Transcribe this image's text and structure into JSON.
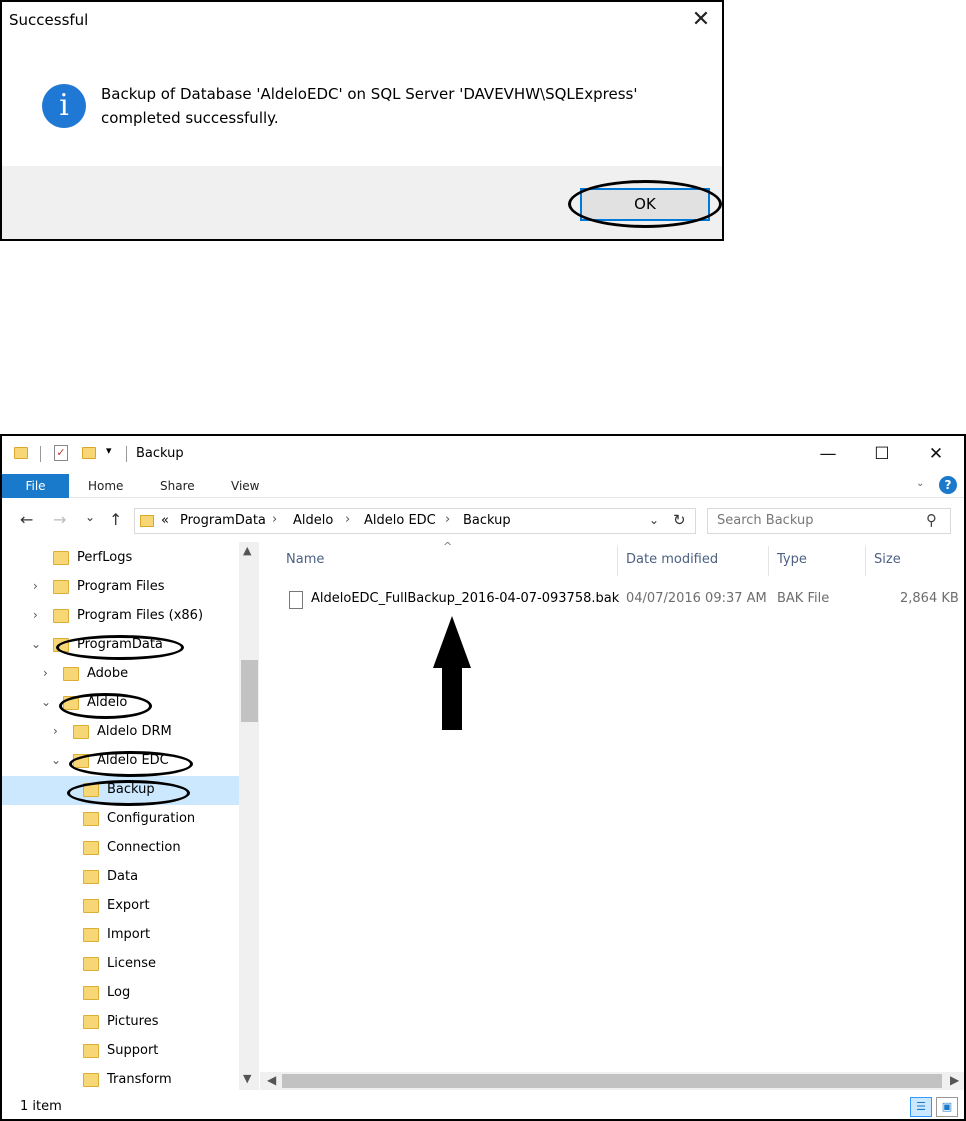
{
  "dialog": {
    "title": "Successful",
    "close_glyph": "✕",
    "icon": "information-icon",
    "icon_glyph": "i",
    "message_line1": "Backup of Database 'AldeloEDC' on SQL Server 'DAVEVHW\\SQLExpress'",
    "message_line2": "completed successfully.",
    "ok_label": "OK"
  },
  "explorer": {
    "window_title": "Backup",
    "quick_access_dropdown": "▾",
    "controls": {
      "minimize": "—",
      "maximize": "☐",
      "close": "✕"
    },
    "ribbon": {
      "file": "File",
      "home": "Home",
      "share": "Share",
      "view": "View",
      "help_glyph": "?"
    },
    "nav": {
      "back": "←",
      "forward": "→",
      "recent": "⌄",
      "up": "↑"
    },
    "address": {
      "overflow": "«",
      "parts": [
        "ProgramData",
        "Aldelo",
        "Aldelo EDC",
        "Backup"
      ],
      "separator": "›"
    },
    "search": {
      "placeholder": "Search Backup"
    },
    "tree": [
      {
        "label": "PerfLogs",
        "arrow": ""
      },
      {
        "label": "Program Files",
        "arrow": "›"
      },
      {
        "label": "Program Files (x86)",
        "arrow": "›"
      },
      {
        "label": "ProgramData",
        "arrow": "⌄"
      },
      {
        "label": "Adobe",
        "arrow": "›"
      },
      {
        "label": "Aldelo",
        "arrow": "⌄"
      },
      {
        "label": "Aldelo DRM",
        "arrow": "›"
      },
      {
        "label": "Aldelo EDC",
        "arrow": "⌄"
      },
      {
        "label": "Backup",
        "arrow": ""
      },
      {
        "label": "Configuration",
        "arrow": ""
      },
      {
        "label": "Connection",
        "arrow": ""
      },
      {
        "label": "Data",
        "arrow": ""
      },
      {
        "label": "Export",
        "arrow": ""
      },
      {
        "label": "Import",
        "arrow": ""
      },
      {
        "label": "License",
        "arrow": ""
      },
      {
        "label": "Log",
        "arrow": ""
      },
      {
        "label": "Pictures",
        "arrow": ""
      },
      {
        "label": "Support",
        "arrow": ""
      },
      {
        "label": "Transform",
        "arrow": ""
      }
    ],
    "columns": {
      "name": "Name",
      "date": "Date modified",
      "type": "Type",
      "size": "Size"
    },
    "sort_indicator": "^",
    "files": [
      {
        "name": "AldeloEDC_FullBackup_2016-04-07-093758.bak",
        "date": "04/07/2016 09:37 AM",
        "type": "BAK File",
        "size": "2,864 KB"
      }
    ],
    "status": "1 item"
  }
}
